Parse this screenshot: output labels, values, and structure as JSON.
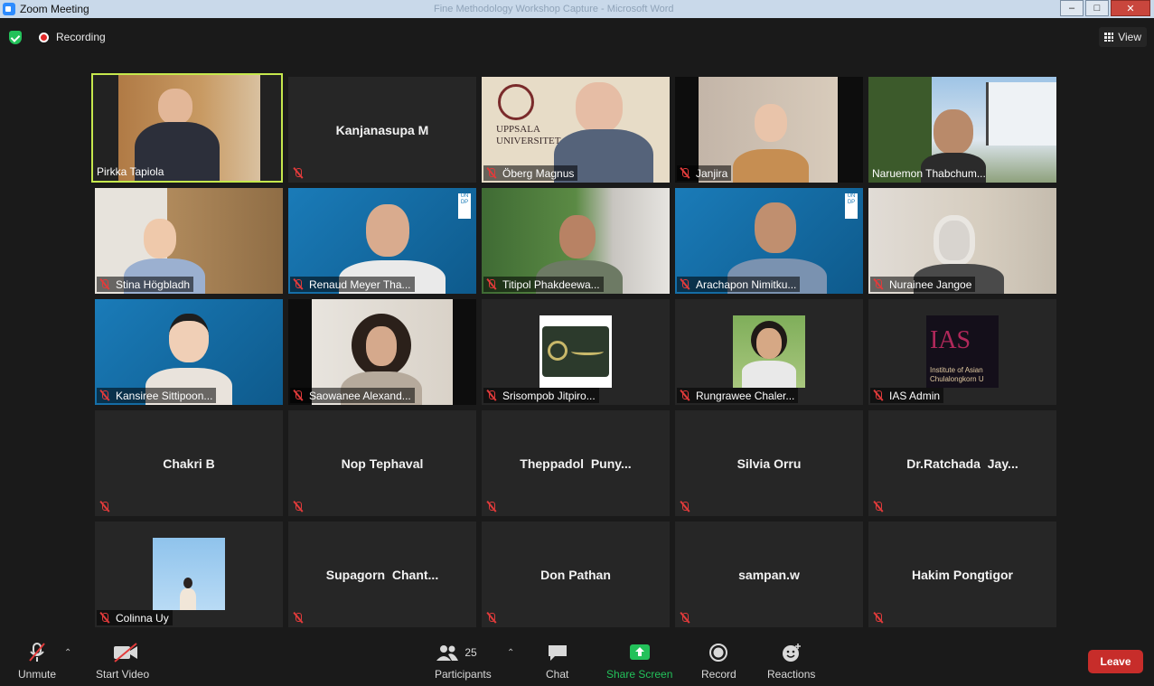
{
  "window": {
    "title": "Zoom Meeting",
    "ghost_title": "Fine Methodology Workshop Capture - Microsoft Word"
  },
  "topbar": {
    "recording_label": "Recording",
    "view_label": "View"
  },
  "participants": [
    {
      "name": "Pirkka Tapiola",
      "video": true,
      "muted": false,
      "speaking": true
    },
    {
      "name": "Kanjanasupa M",
      "video": false,
      "muted": true
    },
    {
      "name": "Öberg Magnus",
      "video": true,
      "muted": true
    },
    {
      "name": "Janjira",
      "video": true,
      "muted": true
    },
    {
      "name": "Naruemon Thabchum...",
      "video": true,
      "muted": false
    },
    {
      "name": "Stina Högbladh",
      "video": true,
      "muted": true
    },
    {
      "name": "Renaud Meyer Tha...",
      "video": true,
      "muted": true
    },
    {
      "name": "Titipol Phakdeewa...",
      "video": true,
      "muted": true
    },
    {
      "name": "Arachapon Nimitku...",
      "video": true,
      "muted": true
    },
    {
      "name": "Nurainee Jangoe",
      "video": true,
      "muted": true
    },
    {
      "name": "Kansiree Sittipoon...",
      "video": true,
      "muted": true
    },
    {
      "name": "Saowanee Alexand...",
      "video": true,
      "muted": true
    },
    {
      "name": "Srisompob Jitpiro...",
      "video": false,
      "muted": true,
      "avatar": "logo"
    },
    {
      "name": "Rungrawee Chaler...",
      "video": false,
      "muted": true,
      "avatar": "photo"
    },
    {
      "name": "IAS Admin",
      "video": false,
      "muted": true,
      "avatar": "ias-logo"
    },
    {
      "name": "Chakri B",
      "video": false,
      "muted": true
    },
    {
      "name": "Nop Tephaval",
      "video": false,
      "muted": true
    },
    {
      "name": "Theppadol  Puny...",
      "video": false,
      "muted": true
    },
    {
      "name": "Silvia Orru",
      "video": false,
      "muted": true
    },
    {
      "name": "Dr.Ratchada  Jay...",
      "video": false,
      "muted": true
    },
    {
      "name": "Colinna Uy",
      "video": false,
      "muted": true,
      "avatar": "photo"
    },
    {
      "name": "Supagorn  Chant...",
      "video": false,
      "muted": true
    },
    {
      "name": "Don Pathan",
      "video": false,
      "muted": true
    },
    {
      "name": "sampan.w",
      "video": false,
      "muted": true
    },
    {
      "name": "Hakim Pongtigor",
      "video": false,
      "muted": true
    }
  ],
  "logos": {
    "uppsala": "UPPSALA UNIVERSITET",
    "undp": "UN DP",
    "ias_title": "IAS",
    "ias_sub1": "Institute of Asian",
    "ias_sub2": "Chulalongkorn U"
  },
  "toolbar": {
    "unmute": "Unmute",
    "start_video": "Start Video",
    "participants": "Participants",
    "participant_count": "25",
    "chat": "Chat",
    "share_screen": "Share Screen",
    "record": "Record",
    "reactions": "Reactions",
    "leave": "Leave"
  },
  "colors": {
    "speaking_border": "#c6e84d",
    "share_green": "#23c15a",
    "leave_red": "#c72d2a",
    "mute_red": "#e23b3b"
  }
}
